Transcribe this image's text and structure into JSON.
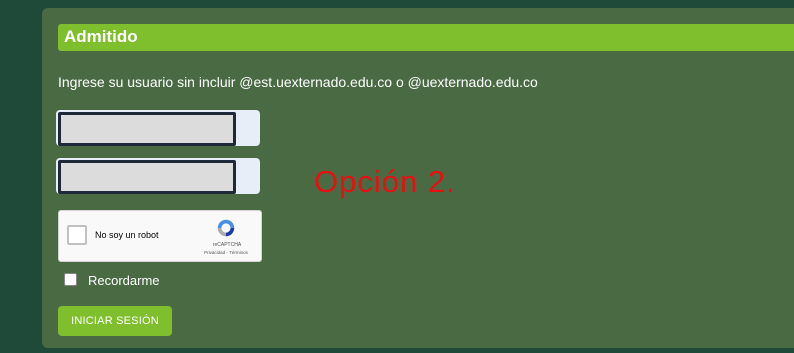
{
  "header": {
    "title": "Admitido"
  },
  "login": {
    "instructions": "Ingrese su usuario sin incluir @est.uexternado.edu.co o @uexternado.edu.co",
    "annotation": "Opción 2.",
    "recaptcha": {
      "label": "No soy un robot",
      "brand": "reCAPTCHA",
      "terms": "Privacidad - Términos"
    },
    "remember_label": "Recordarme",
    "submit_label": "INICIAR SESIÓN"
  },
  "colors": {
    "background": "#1f4a3a",
    "panel": "#4a6a44",
    "accent": "#7fbf2e",
    "annotation": "#e61010"
  }
}
